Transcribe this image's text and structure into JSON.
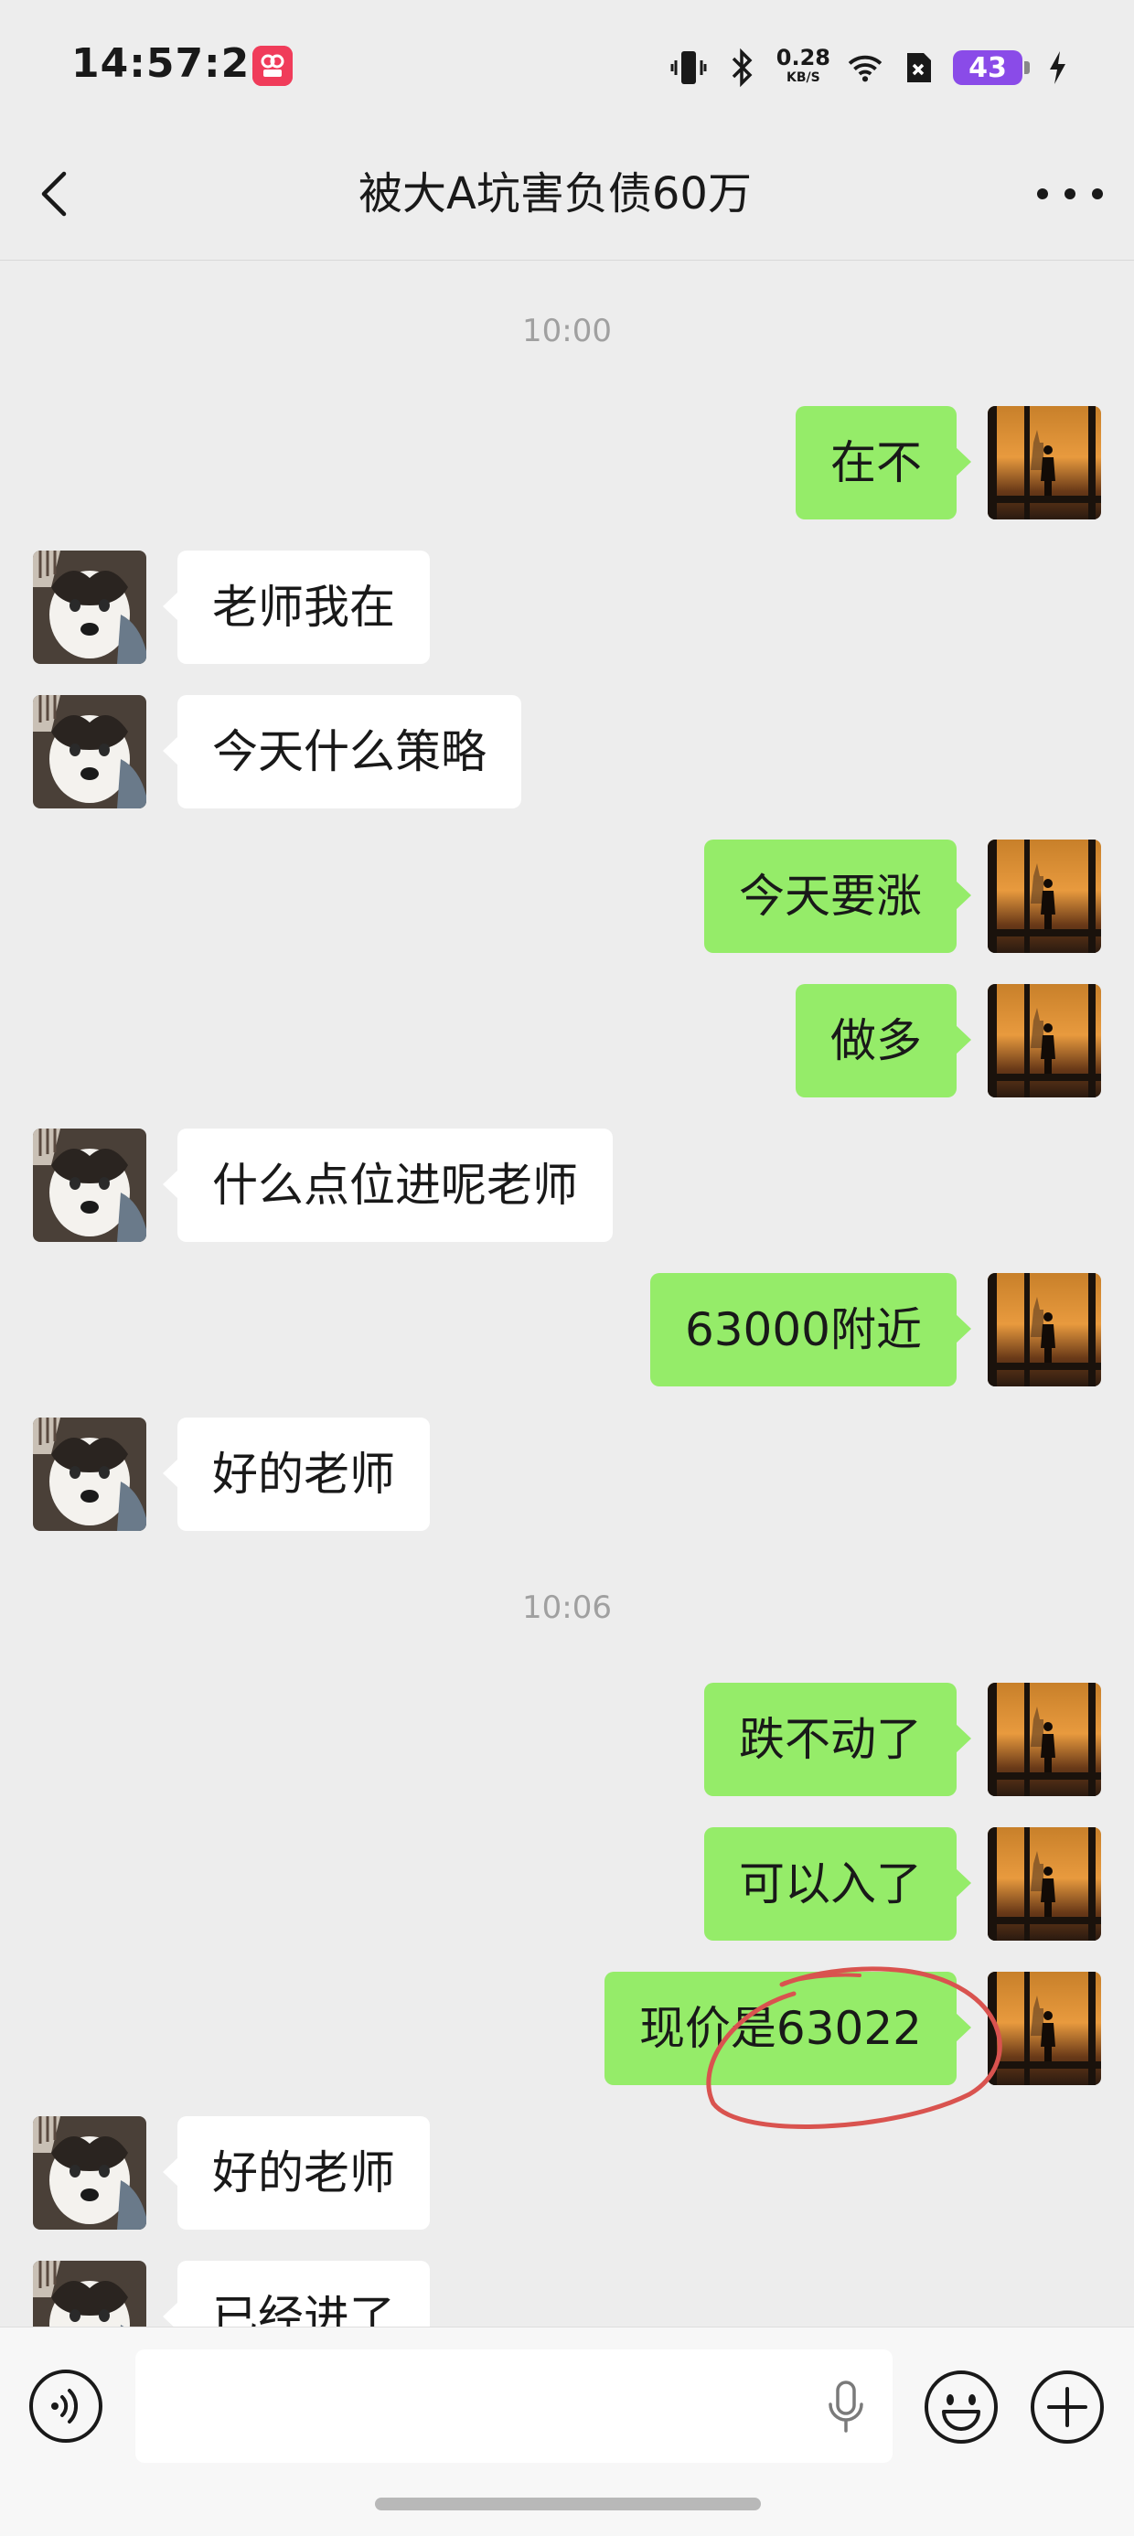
{
  "status_bar": {
    "time": "14:57:28",
    "net_speed_value": "0.28",
    "net_speed_unit": "KB/S",
    "battery": "43",
    "icons": [
      "vibrate-icon",
      "bluetooth-icon",
      "wifi-icon",
      "sim-icon",
      "charging-icon"
    ]
  },
  "nav": {
    "title": "被大A坑害负债60万"
  },
  "chat": {
    "timestamps": [
      "10:00",
      "10:06"
    ],
    "messages": [
      {
        "side": "self",
        "text": "在不"
      },
      {
        "side": "other",
        "text": "老师我在"
      },
      {
        "side": "other",
        "text": "今天什么策略"
      },
      {
        "side": "self",
        "text": "今天要涨"
      },
      {
        "side": "self",
        "text": "做多"
      },
      {
        "side": "other",
        "text": "什么点位进呢老师"
      },
      {
        "side": "self",
        "text": "63000附近"
      },
      {
        "side": "other",
        "text": "好的老师"
      },
      {
        "side": "self",
        "text": "跌不动了"
      },
      {
        "side": "self",
        "text": "可以入了"
      },
      {
        "side": "self",
        "text": "现价是63022"
      },
      {
        "side": "other",
        "text": "好的老师"
      },
      {
        "side": "other",
        "text": "已经进了"
      }
    ]
  },
  "colors": {
    "self_bubble": "#95ec69",
    "other_bubble": "#ffffff",
    "background": "#ededed",
    "annotation": "#d9534f"
  }
}
